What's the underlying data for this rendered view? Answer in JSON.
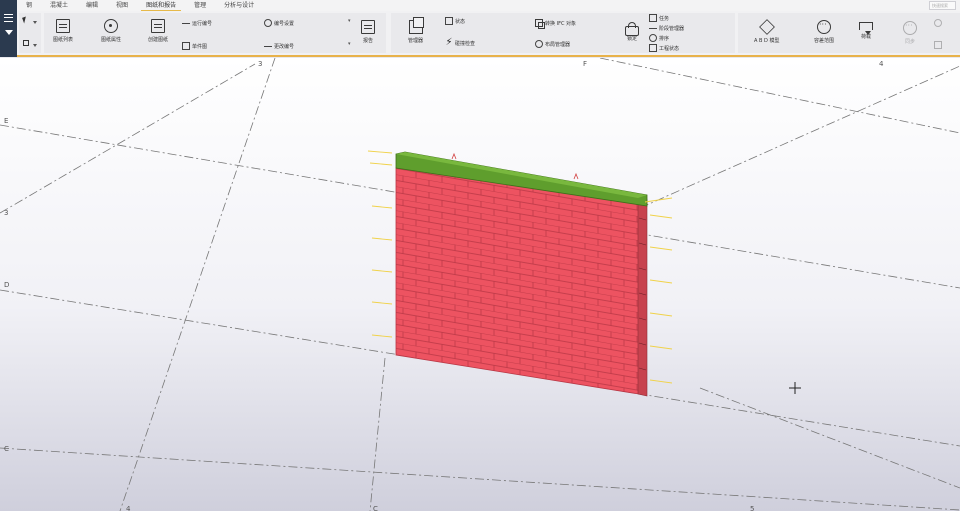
{
  "tabs": [
    "钢",
    "混凝土",
    "编辑",
    "视图",
    "图纸和报告",
    "管理",
    "分析与设计"
  ],
  "active_tab": "图纸和报告",
  "search": {
    "placeholder": "快速搜索"
  },
  "ribbon": {
    "drawing_list": "图纸列表",
    "drawing_props": "图纸属性",
    "create_sheet": "创建图纸",
    "numbering": "运行编号",
    "single_part": "单件图",
    "numbering_settings": "编号设置",
    "change_number": "更改编号",
    "report": "报告",
    "organizer": "管理器",
    "status": "状态",
    "clash_check": "碰撞检查",
    "convert_ifc": "转换 IFC 对象",
    "layout_manager": "布局管理器",
    "lock": "锁定",
    "task": "任务",
    "phase_manager": "阶段管理器",
    "sequence": "排序",
    "project_status": "工程状态",
    "abd_model": "A B D 模型",
    "measure": "容差范围",
    "load": "荷载",
    "sync": "同步",
    "link": "连接"
  },
  "grid_labels": [
    "3",
    "F",
    "4",
    "E",
    "3",
    "D",
    "C",
    "4",
    "C",
    "5"
  ],
  "colors": {
    "wall": "#ed5361",
    "wall_side": "#c7424e",
    "top_beam": "#5f9e2d",
    "accent": "#e8b24a",
    "grid": "#666666"
  }
}
